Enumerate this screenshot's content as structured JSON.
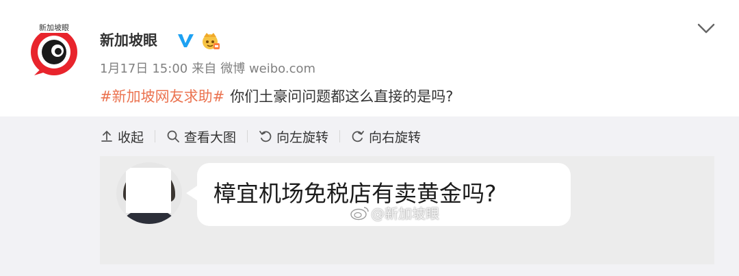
{
  "post": {
    "avatar_tag": "新加坡眼",
    "username": "新加坡眼",
    "meta": {
      "date": "1月17日",
      "time": "15:00",
      "source_prefix": "来自",
      "source": "微博 weibo.com"
    },
    "hashtag": "#新加坡网友求助#",
    "text": "你们土豪问问题都这么直接的是吗?"
  },
  "toolbar": {
    "collapse_label": "收起",
    "view_large_label": "查看大图",
    "rotate_left_label": "向左旋转",
    "rotate_right_label": "向右旋转"
  },
  "image": {
    "bubble_text": "樟宜机场免税店有卖黄金吗?",
    "watermark": "@新加坡眼"
  },
  "colors": {
    "hashtag": "#eb7350",
    "verified": "#1da1f2",
    "panel_bg": "#f2f2f5"
  },
  "icons": [
    "verified-icon",
    "vip-crown-icon",
    "chevron-down-icon",
    "upload-arrow-icon",
    "search-icon",
    "rotate-left-icon",
    "rotate-right-icon",
    "weibo-logo-icon"
  ]
}
